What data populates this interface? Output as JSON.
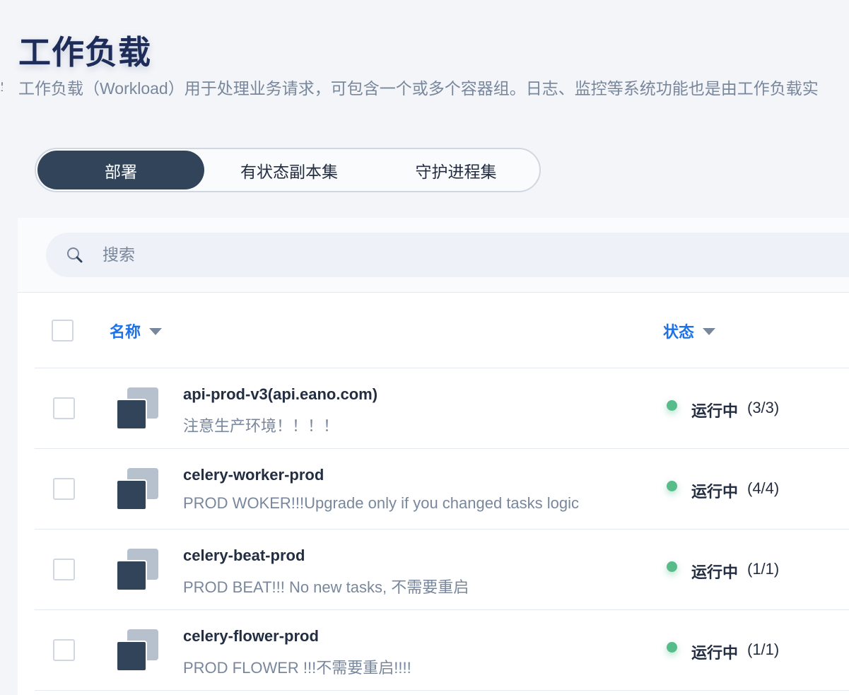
{
  "page": {
    "title": "工作负载",
    "description": "工作负载（Workload）用于处理业务请求，可包含一个或多个容器组。日志、监控等系统功能也是由工作负载实"
  },
  "tabs": [
    {
      "label": "部署",
      "active": true
    },
    {
      "label": "有状态副本集",
      "active": false
    },
    {
      "label": "守护进程集",
      "active": false
    }
  ],
  "search": {
    "placeholder": "搜索",
    "value": ""
  },
  "table": {
    "columns": {
      "name": "名称",
      "status": "状态"
    },
    "rows": [
      {
        "name": "api-prod-v3(api.eano.com)",
        "description": "注意生产环境！！！！",
        "status": "运行中",
        "replicas": "(3/3)"
      },
      {
        "name": "celery-worker-prod",
        "description": "PROD WOKER!!!Upgrade only if you changed tasks logic",
        "status": "运行中",
        "replicas": "(4/4)"
      },
      {
        "name": "celery-beat-prod",
        "description": "PROD BEAT!!! No new tasks, 不需要重启",
        "status": "运行中",
        "replicas": "(1/1)"
      },
      {
        "name": "celery-flower-prod",
        "description": "PROD FLOWER !!!不需要重启!!!!",
        "status": "运行中",
        "replicas": "(1/1)"
      }
    ]
  },
  "colors": {
    "title": "#1e2c5a",
    "active_tab": "#324459",
    "column_header": "#1d72e8",
    "status_running": "#55bc8a"
  },
  "icons": {
    "search": "search-icon",
    "workload": "workload-icon",
    "sort": "caret-down-icon"
  }
}
